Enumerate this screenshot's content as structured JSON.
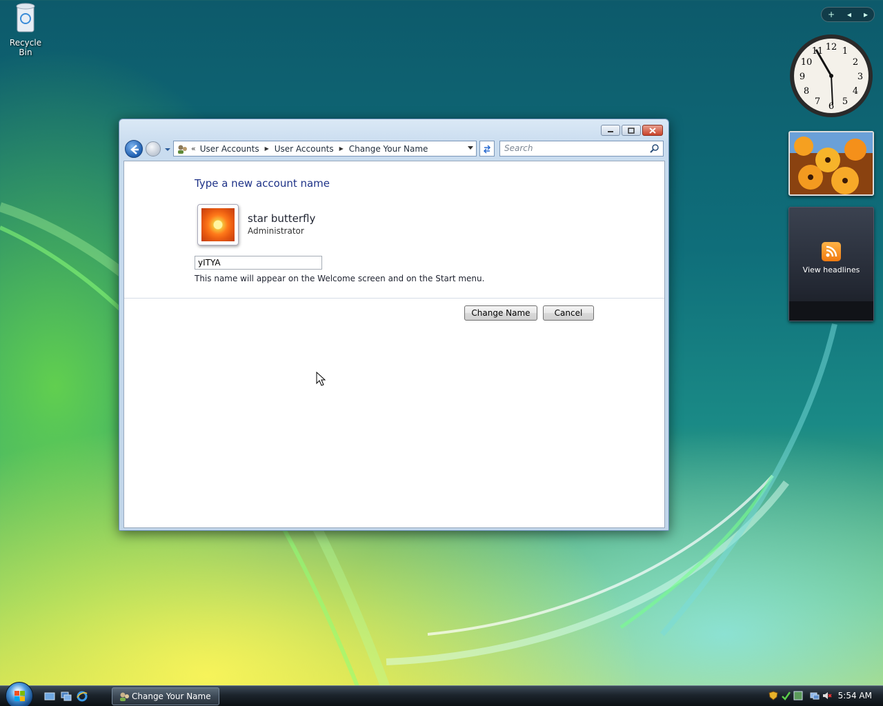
{
  "desktop": {
    "recycle_bin_label": "Recycle Bin"
  },
  "gadgets": {
    "feeds_label": "View headlines",
    "clock_numbers": [
      "12",
      "1",
      "2",
      "3",
      "4",
      "5",
      "6",
      "7",
      "8",
      "9",
      "10",
      "11"
    ]
  },
  "window": {
    "address_parts": [
      "User Accounts",
      "User Accounts",
      "Change Your Name"
    ],
    "search_placeholder": "Search",
    "heading": "Type a new account name",
    "user_name": "star butterfly",
    "user_role": "Administrator",
    "name_value": "yITYA",
    "hint": "This name will appear on the Welcome screen and on the Start menu.",
    "change_button": "Change Name",
    "cancel_button": "Cancel"
  },
  "taskbar": {
    "task_label": "Change Your Name",
    "clock": "5:54 AM"
  },
  "colors": {
    "heading": "#1e3287",
    "accent": "#2a6bd0"
  }
}
